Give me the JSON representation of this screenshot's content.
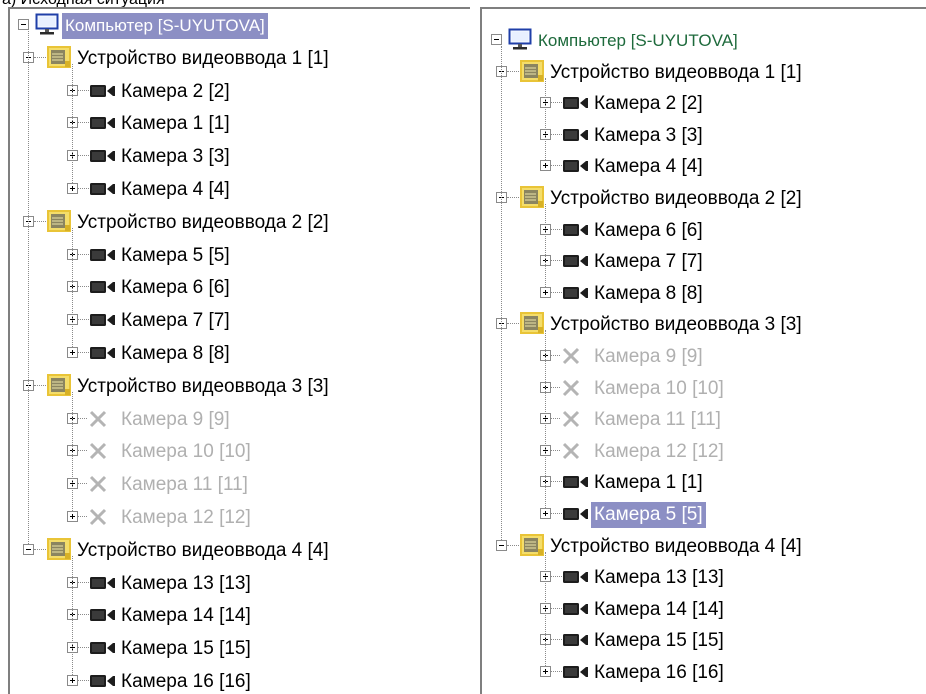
{
  "caption": "а) Исходная ситуация",
  "left_tree": {
    "computer": "Компьютер [S-UYUTOVA]",
    "devices": [
      {
        "label": "Устройство видеоввода 1 [1]",
        "cameras": [
          {
            "label": "Камера 2 [2]",
            "enabled": true
          },
          {
            "label": "Камера 1 [1]",
            "enabled": true
          },
          {
            "label": "Камера 3 [3]",
            "enabled": true
          },
          {
            "label": "Камера 4 [4]",
            "enabled": true
          }
        ]
      },
      {
        "label": "Устройство видеоввода 2 [2]",
        "cameras": [
          {
            "label": "Камера 5 [5]",
            "enabled": true
          },
          {
            "label": "Камера 6 [6]",
            "enabled": true
          },
          {
            "label": "Камера 7 [7]",
            "enabled": true
          },
          {
            "label": "Камера 8 [8]",
            "enabled": true
          }
        ]
      },
      {
        "label": "Устройство видеоввода 3 [3]",
        "cameras": [
          {
            "label": "Камера 9 [9]",
            "enabled": false
          },
          {
            "label": "Камера 10 [10]",
            "enabled": false
          },
          {
            "label": "Камера 11 [11]",
            "enabled": false
          },
          {
            "label": "Камера 12 [12]",
            "enabled": false
          }
        ]
      },
      {
        "label": "Устройство видеоввода 4 [4]",
        "cameras": [
          {
            "label": "Камера 13 [13]",
            "enabled": true
          },
          {
            "label": "Камера 14 [14]",
            "enabled": true
          },
          {
            "label": "Камера 15 [15]",
            "enabled": true
          },
          {
            "label": "Камера 16 [16]",
            "enabled": true
          }
        ]
      }
    ]
  },
  "right_tree": {
    "computer": "Компьютер [S-UYUTOVA]",
    "devices": [
      {
        "label": "Устройство видеоввода 1 [1]",
        "cameras": [
          {
            "label": "Камера 2 [2]",
            "enabled": true
          },
          {
            "label": "Камера 3 [3]",
            "enabled": true
          },
          {
            "label": "Камера 4 [4]",
            "enabled": true
          }
        ]
      },
      {
        "label": "Устройство видеоввода 2 [2]",
        "cameras": [
          {
            "label": "Камера 6 [6]",
            "enabled": true
          },
          {
            "label": "Камера 7 [7]",
            "enabled": true
          },
          {
            "label": "Камера 8 [8]",
            "enabled": true
          }
        ]
      },
      {
        "label": "Устройство видеоввода 3 [3]",
        "cameras": [
          {
            "label": "Камера 9 [9]",
            "enabled": false
          },
          {
            "label": "Камера 10 [10]",
            "enabled": false
          },
          {
            "label": "Камера 11 [11]",
            "enabled": false
          },
          {
            "label": "Камера 12 [12]",
            "enabled": false
          },
          {
            "label": "Камера 1 [1]",
            "enabled": true
          },
          {
            "label": "Камера 5 [5]",
            "enabled": true,
            "selected": true
          }
        ]
      },
      {
        "label": "Устройство видеоввода 4 [4]",
        "cameras": [
          {
            "label": "Камера 13 [13]",
            "enabled": true
          },
          {
            "label": "Камера 14 [14]",
            "enabled": true
          },
          {
            "label": "Камера 15 [15]",
            "enabled": true
          },
          {
            "label": "Камера 16 [16]",
            "enabled": true
          }
        ]
      }
    ]
  },
  "icons": {
    "computer": "monitor-icon",
    "device": "capture-card-icon",
    "camera": "camera-icon",
    "disabled_camera": "cross-icon"
  },
  "colors": {
    "computer_text": "#1e6a3c",
    "disabled_text": "#b0b0b0",
    "selection_bg": "#8c8fc4",
    "computer_selected_bg": "#8c8fc4"
  }
}
